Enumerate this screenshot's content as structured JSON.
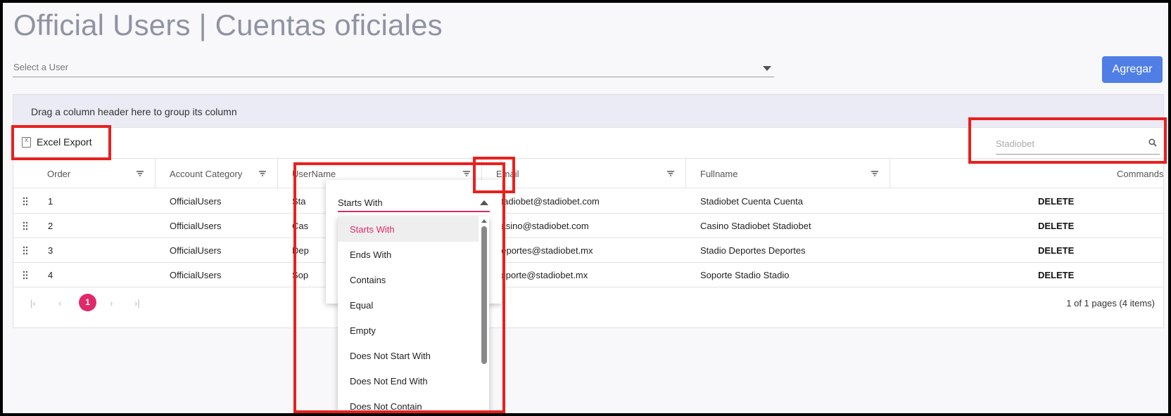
{
  "page": {
    "title": "Official Users | Cuentas oficiales"
  },
  "user_select": {
    "placeholder": "Select a User"
  },
  "actions": {
    "add_label": "Agregar"
  },
  "grid": {
    "group_panel_text": "Drag a column header here to group its column",
    "toolbar": {
      "excel_export_label": "Excel Export",
      "search_value": "",
      "search_placeholder": "Stadiobet"
    },
    "columns": [
      "Order",
      "Account Category",
      "UserName",
      "Email",
      "Fullname",
      "Commands"
    ],
    "rows": [
      {
        "order": "1",
        "category": "OfficialUsers",
        "username": "Sta",
        "email": "stadiobet@stadiobet.com",
        "fullname": "Stadiobet Cuenta Cuenta",
        "command": "DELETE"
      },
      {
        "order": "2",
        "category": "OfficialUsers",
        "username": "Cas",
        "email": "casino@stadiobet.com",
        "fullname": "Casino Stadiobet Stadiobet",
        "command": "DELETE"
      },
      {
        "order": "3",
        "category": "OfficialUsers",
        "username": "Dep",
        "email": "deportes@stadiobet.mx",
        "fullname": "Stadio Deportes Deportes",
        "command": "DELETE"
      },
      {
        "order": "4",
        "category": "OfficialUsers",
        "username": "Sop",
        "email": "soporte@stadiobet.mx",
        "fullname": "Soporte Stadio Stadio",
        "command": "DELETE"
      }
    ],
    "pager": {
      "current_page": "1",
      "info": "1 of 1 pages (4 items)"
    }
  },
  "filter_menu": {
    "selected_operator": "Starts With",
    "operators": [
      "Starts With",
      "Ends With",
      "Contains",
      "Equal",
      "Empty",
      "Does Not Start With",
      "Does Not End With",
      "Does Not Contain"
    ]
  },
  "colors": {
    "accent": "#e0296a",
    "primary_button": "#4f7fe5",
    "highlight": "#e8201f",
    "group_panel": "#eaebf5"
  }
}
